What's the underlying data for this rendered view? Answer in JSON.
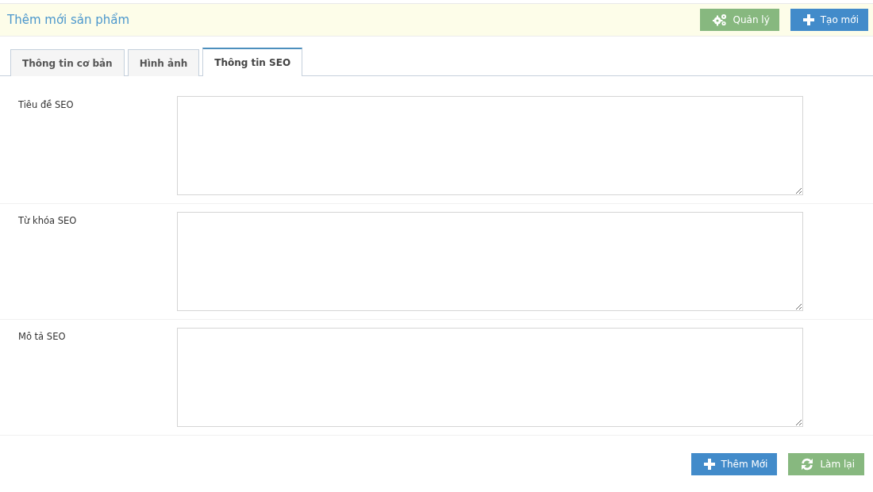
{
  "header": {
    "title": "Thêm mới sản phẩm",
    "buttons": [
      {
        "label": "Quản lý",
        "kind": "manage"
      },
      {
        "label": "Tạo mới",
        "kind": "create"
      }
    ]
  },
  "tabs": [
    {
      "label": "Thông tin cơ bản",
      "selected": false
    },
    {
      "label": "Hình ảnh",
      "selected": false
    },
    {
      "label": "Thông tin SEO",
      "selected": true
    }
  ],
  "fields": [
    {
      "label": "Tiêu đề SEO"
    },
    {
      "label": "Từ khóa SEO"
    },
    {
      "label": "Mô tả SEO"
    }
  ],
  "actions": [
    {
      "label": "Thêm Mới",
      "kind": "create"
    },
    {
      "label": "Làm lại",
      "kind": "reset"
    }
  ]
}
